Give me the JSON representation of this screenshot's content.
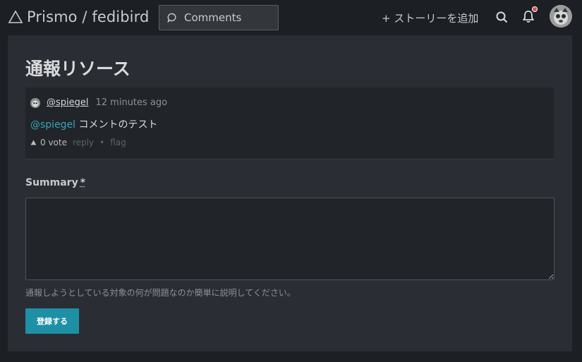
{
  "header": {
    "brand": "Prismo / fedibird",
    "search_label": "Comments",
    "add_story_label": "+ ストーリーを追加"
  },
  "page": {
    "title": "通報リソース"
  },
  "comment": {
    "username": "@spiegel",
    "time": "12 minutes ago",
    "mention": "@spiegel",
    "text": " コメントのテスト",
    "votes": "0 vote",
    "reply_label": "reply",
    "separator": "•",
    "flag_label": "flag"
  },
  "form": {
    "summary_label": "Summary",
    "required_mark": "*",
    "summary_value": "",
    "hint": "通報しようとしている対象の何が問題なのか簡単に説明してください。",
    "submit_label": "登録する"
  },
  "colors": {
    "accent": "#1f8fa6",
    "mention": "#3aa4b8",
    "notification_dot": "#e2434d",
    "panel_bg": "#2a2d33",
    "page_bg": "#1c1f23"
  }
}
